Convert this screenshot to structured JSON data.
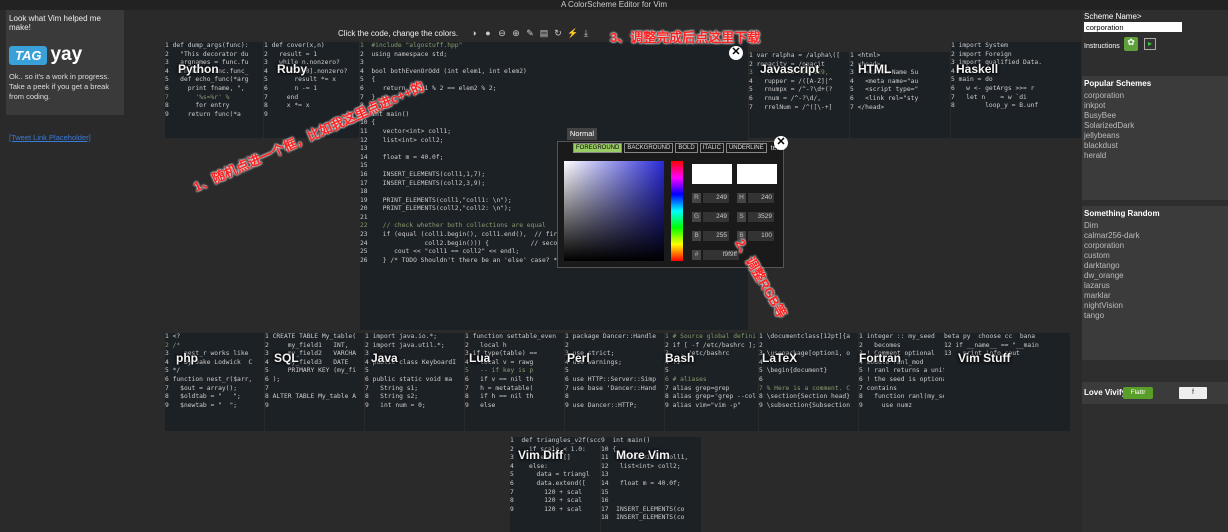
{
  "app_title": "A ColorScheme Editor for Vim",
  "left": {
    "intro": "Look what Vim helped me make!",
    "logo_tag": "TAG",
    "logo_yay": "yay",
    "blurb": "Ok.. so it's a work in progress. Take a peek if you get a break from coding.",
    "link": "[Tweet Link Placeholder]"
  },
  "toolbar": {
    "hint": "Click the code, change the colors.",
    "icons": [
      "contrast-icon",
      "ink-icon",
      "minus-icon",
      "plus-icon",
      "edit-icon",
      "folder-icon",
      "refresh-icon",
      "magic-icon",
      "download-icon"
    ]
  },
  "annotations": {
    "a1": "1、随机点进一个框，比如我这里点进c++的",
    "a2": "2、调整RGB等",
    "a3": "3、调整完成后点这里下载"
  },
  "right": {
    "scheme_label": "Scheme Name>",
    "scheme_value": "corporation",
    "instructions": "Instructions",
    "popular_title": "Popular Schemes",
    "popular": [
      "corporation",
      "inkpot",
      "BusyBee",
      "SolarizedDark",
      "jellybeans",
      "blackdust",
      "herald"
    ],
    "random_title": "Something Random",
    "random": [
      "Dim",
      "calmar256-dark",
      "corporation",
      "custom",
      "darktango",
      "dw_orange",
      "lazarus",
      "marklar",
      "nightVision",
      "tango"
    ],
    "love": "Love Vivify?",
    "flattr": "Flattr",
    "fb": "f"
  },
  "panel_labels": {
    "python": "Python",
    "ruby": "Ruby",
    "javascript": "Javascript",
    "html": "HTML",
    "haskell": "Haskell",
    "php": "php",
    "sql": "SQL",
    "java": "Java",
    "lua": "Lua",
    "perl": "Perl",
    "bash": "Bash",
    "latex": "LaTeX",
    "fortran": "Fortran",
    "vimstuff": "Vim Stuff",
    "vimdiff": "Vim Diff",
    "morevim": "More Vim"
  },
  "picker": {
    "normal": "Normal",
    "tabs": [
      "FOREGROUND",
      "BACKGROUND",
      "BOLD",
      "ITALIC",
      "UNDERLINE",
      "term"
    ],
    "R": "249",
    "G": "249",
    "B": "255",
    "H": "240",
    "S": "3529",
    "V": "100",
    "hex": "f9f9ff"
  },
  "code": {
    "cpp": [
      "1  #include \"algostuff.hpp\"",
      "2  using namespace std;",
      "3",
      "4  bool bothEvenOrOdd (int elem1, int elem2)",
      "5  {",
      "6     return elem1 % 2 == elem2 % 2;",
      "7  }",
      "8",
      "9  int main()",
      "10 {",
      "11    vector<int> coll1;",
      "12    list<int> coll2;",
      "13",
      "14    float m = 40.0f;",
      "15",
      "16    INSERT_ELEMENTS(coll1,1,7);",
      "17    INSERT_ELEMENTS(coll2,3,9);",
      "18",
      "19    PRINT_ELEMENTS(coll1,\"coll1: \\n\");",
      "20    PRINT_ELEMENTS(coll2,\"coll2: \\n\");",
      "21",
      "22    // check whether both collections are equal",
      "23    if (equal (coll1.begin(), coll1.end(),  // first range",
      "24               coll2.begin())) {           // second range",
      "25       cout << \"coll1 == coll2\" << endl;",
      "26    } /* TODO Shouldn't there be an 'else' case? */"
    ],
    "python": [
      "1 def dump_args(func):",
      "2   \"This decorator du",
      "3   argnames = func.fu",
      "4   fname = func.func_",
      "5   def echo_func(*arg",
      "6     print fname, \",",
      "7       '%s=%r' %",
      "8       for entry",
      "9     return func(*a"
    ],
    "ruby": [
      "1 def cover(x,n)",
      "2   result = 1",
      "3   while n.nonzero?",
      "4     if n[0].nonzero?",
      "5       result *= x",
      "6       n -= 1",
      "7     end",
      "8     x *= x",
      "9"
    ],
    "js": [
      "1 var ralpha = /alpha\\([",
      "2 ropacity = /opacit",
      "3   // fixed for IE9,",
      "4   rupper = /([A-Z]|^",
      "5   rnumpx = /^-?\\d+(?",
      "6   rnum = /^-?\\d/,",
      "7   rrelNum = /^([\\-+]"
    ],
    "html": [
      "1 <html>",
      "2 <head>",
      "3   <title>Name Su",
      "4   <meta name=\"au",
      "5   <script type=\"",
      "6   <link rel=\"sty",
      "7 </head>"
    ],
    "haskell": [
      "1 import System",
      "2 import Foreign",
      "3 import qualified Data.",
      "4",
      "5 main = do",
      "6   w <- getArgs >>= r",
      "7   let n    = w `di",
      "8        loop_y = B.unf"
    ],
    "php": [
      "1 <?",
      "2 /*",
      "3    nest_r works like",
      "4    By Jake Lodwick  C",
      "5 */",
      "6 function nest_r($arr,",
      "7   $out = array();",
      "8   $oldtab = \"   \";",
      "9   $newtab = \"  \";"
    ],
    "sql": [
      "1 CREATE TABLE My_table(",
      "2     my_field1   INT,",
      "3     my_field2   VARCHA",
      "4     my_field3   DATE",
      "5     PRIMARY KEY (my_fi",
      "6 );",
      "7",
      "8 ALTER TABLE My_table A",
      "9"
    ],
    "java": [
      "1 import java.io.*;",
      "2 import java.util.*;",
      "3",
      "4 public class KeyboardI",
      "5",
      "6 public static void ma",
      "7   String s1;",
      "8   String s2;",
      "9   int num = 0;"
    ],
    "lua": [
      "1 function settable_even",
      "2   local h",
      "3 if type(table) ==",
      "4   local v = rawg",
      "5   -- if key is p",
      "6   if v == nil th",
      "7   h = metatable(",
      "8   if h == nil th",
      "9   else"
    ],
    "perl": [
      "1 package Dancer::Handle",
      "2",
      "3 use strict;",
      "4 use warnings;",
      "5",
      "6 use HTTP::Server::Simp",
      "7 use base 'Dancer::Hand",
      "8",
      "9 use Dancer::HTTP;"
    ],
    "bash": [
      "1 # Source global defini",
      "2 if [ -f /etc/bashrc ];",
      "3   . /etc/bashrc",
      "4 fi",
      "5",
      "6 # aliases",
      "7 alias grep=grep",
      "8 alias grep='grep --col",
      "9 alias vim=\"vim -p\""
    ],
    "latex": [
      "1 \\documentclass[12pt]{a",
      "2",
      "3 \\usepackage[option1, o",
      "4",
      "5 \\begin{document}",
      "6",
      "7 % Here is a comment. C",
      "8 \\section{Section head}",
      "9 \\subsection{Subsection"
    ],
    "fortran": [
      "1 integer :: my_seed",
      "2   becomes",
      "3 ! Comment optional",
      "4 module ranl_mod",
      "5 ! ranl returns a unifo",
      "6 ! the seed is optional",
      "7 contains",
      "8   function ranl(my_se",
      "9     use numz"
    ],
    "vimstuff": [
      "beta py  choose cc  bana",
      "",
      "",
      "",
      "",
      "",
      "12 if __name__ == \"__main",
      "13   print info.cout"
    ],
    "vimdiff": [
      "1  def triangles_v2f(scol",
      "2    if scale < 1.0:",
      "3      return []",
      "4    else:",
      "5      data = triangl",
      "6      data.extend([",
      "7        120 + scal",
      "8        120 + scal",
      "9        120 + scal"
    ],
    "morevim": [
      "9  int main()",
      "10 {",
      "11   vector<int> coll1,",
      "12   list<int> coll2;",
      "13",
      "14   float m = 40.0f;",
      "15",
      "16",
      "17  INSERT_ELEMENTS(co",
      "18  INSERT_ELEMENTS(co"
    ]
  },
  "colors": {
    "accent": "#9acc66",
    "annotation": "#ff2222",
    "panel_bg": "#1c2126"
  }
}
